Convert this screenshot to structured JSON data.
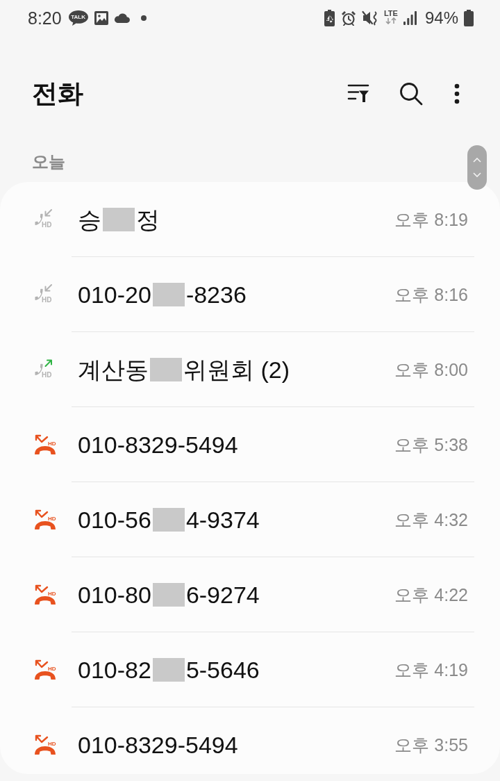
{
  "status_bar": {
    "time": "8:20",
    "notifications": [
      {
        "kind": "talk",
        "label": "TALK"
      },
      {
        "kind": "gallery"
      },
      {
        "kind": "cloud"
      },
      {
        "kind": "dot"
      }
    ],
    "network": "LTE",
    "battery": "94%"
  },
  "header": {
    "title": "전화"
  },
  "section": {
    "label": "오늘"
  },
  "calls": [
    {
      "kind": "incoming",
      "hd_label": "HD",
      "name_parts": [
        "승",
        "정"
      ],
      "time": "오후 8:19"
    },
    {
      "kind": "incoming",
      "hd_label": "HD",
      "name_parts": [
        "010-20",
        "-8236"
      ],
      "time": "오후 8:16"
    },
    {
      "kind": "outgoing",
      "hd_label": "HD",
      "name_parts": [
        "계산동",
        "위원회 (2)"
      ],
      "time": "오후 8:00"
    },
    {
      "kind": "missed",
      "hd_label": "HD",
      "name_parts": [
        "010-8329-5494"
      ],
      "time": "오후 5:38"
    },
    {
      "kind": "missed",
      "hd_label": "HD",
      "name_parts": [
        "010-56",
        "4-9374"
      ],
      "time": "오후 4:32"
    },
    {
      "kind": "missed",
      "hd_label": "HD",
      "name_parts": [
        "010-80",
        "6-9274"
      ],
      "time": "오후 4:22"
    },
    {
      "kind": "missed",
      "hd_label": "HD",
      "name_parts": [
        "010-82",
        "5-5646"
      ],
      "time": "오후 4:19"
    },
    {
      "kind": "missed",
      "hd_label": "HD",
      "name_parts": [
        "010-8329-5494"
      ],
      "time": "오후 3:55"
    }
  ]
}
